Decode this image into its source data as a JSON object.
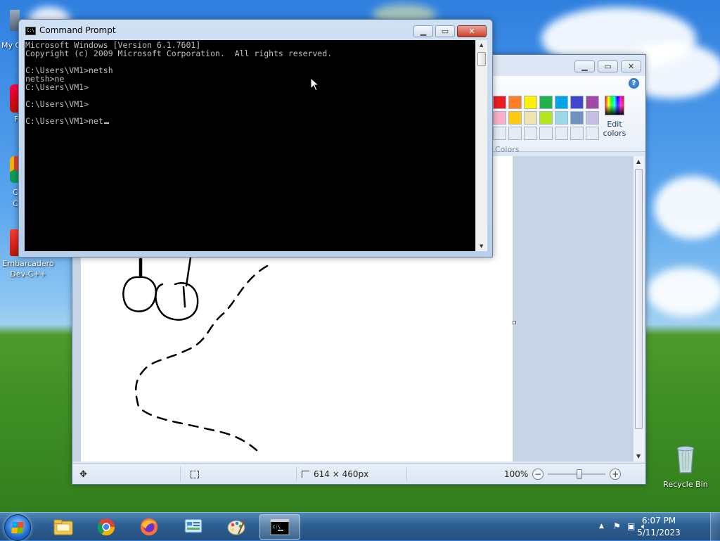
{
  "desktop": {
    "icons": [
      {
        "label": "Embarcadero Dev-C++"
      },
      {
        "label": "Recycle Bin"
      }
    ],
    "partial_labels": [
      "My C",
      "F",
      "C",
      "C"
    ]
  },
  "cmd": {
    "title": "Command Prompt",
    "lines": [
      "Microsoft Windows [Version 6.1.7601]",
      "Copyright (c) 2009 Microsoft Corporation.  All rights reserved.",
      "",
      "C:\\Users\\VM1>netsh",
      "netsh>ne",
      "C:\\Users\\VM1>",
      "",
      "C:\\Users\\VM1>",
      "",
      "C:\\Users\\VM1>net"
    ]
  },
  "paint": {
    "colors_label": "Colors",
    "edit_colors_label": "Edit colors",
    "palette": [
      "#ed1c24",
      "#ff7f27",
      "#fff200",
      "#22b14c",
      "#00a2e8",
      "#3f48cc",
      "#a349a4",
      "#ffaec9",
      "#ffc90e",
      "#efe4b0",
      "#b5e61d",
      "#99d9ea",
      "#7092be",
      "#c8bfe7",
      "#e6ecf4",
      "#e6ecf4",
      "#e6ecf4",
      "#e6ecf4",
      "#e6ecf4",
      "#e6ecf4",
      "#e6ecf4"
    ],
    "status": {
      "image_size": "614 × 460px",
      "zoom": "100%",
      "zoom_level": 0.55
    }
  },
  "taskbar": {
    "time": "6:07 PM",
    "date": "5/11/2023"
  }
}
